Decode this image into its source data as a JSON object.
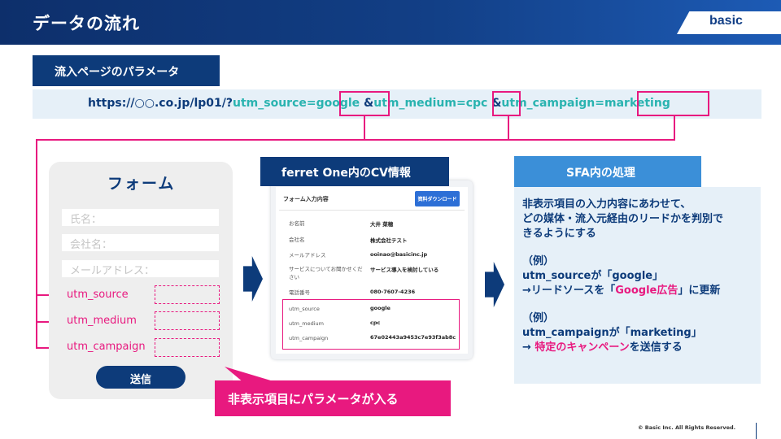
{
  "header": {
    "title": "データの流れ",
    "brand": "basic"
  },
  "params_section": {
    "label": "流入ページのパラメータ",
    "url_prefix": "https://○○.co.jp/lp01/?",
    "p1_key": "utm_source=",
    "p1_value": "google",
    "amp1": "&",
    "p2_key": "utm_medium=",
    "p2_value": "cpc",
    "amp2": "&",
    "p3_key": "utm_campaign=",
    "p3_value": "marketing"
  },
  "form": {
    "title": "フォーム",
    "name_placeholder": "氏名：",
    "company_placeholder": "会社名：",
    "email_placeholder": "メールアドレス：",
    "utm_source": "utm_source",
    "utm_medium": "utm_medium",
    "utm_campaign": "utm_campaign",
    "submit": "送信"
  },
  "callout": "非表示項目にパラメータが入る",
  "ferret": {
    "label": "ferret One内のCV情報",
    "screen_title": "フォーム入力内容",
    "download_button": "資料ダウンロード",
    "rows": [
      {
        "label": "お名前",
        "value": "大井 菜穂"
      },
      {
        "label": "会社名",
        "value": "株式会社テスト"
      },
      {
        "label": "メールアドレス",
        "value": "ooinao@basicinc.jp"
      },
      {
        "label": "サービスについてお聞かせください",
        "value": "サービス導入を検討している"
      },
      {
        "label": "電話番号",
        "value": "080-7607-4236"
      }
    ],
    "utm_rows": [
      {
        "label": "utm_source",
        "value": "google"
      },
      {
        "label": "utm_medium",
        "value": "cpc"
      },
      {
        "label": "utm_campaign",
        "value": "67e02443a9453c7e93f3ab8c"
      }
    ]
  },
  "sfa": {
    "label": "SFA内の処理",
    "desc1": "非表示項目の入力内容にあわせて、",
    "desc2": "どの媒体・流入元経由のリードかを判別で",
    "desc3": "きるようにする",
    "ex1_heading": "（例）",
    "ex1_line1": "utm_sourceが「google」",
    "ex1_line2_pre": "→リードソースを「",
    "ex1_line2_em": "Google広告",
    "ex1_line2_post": "」に更新",
    "ex2_heading": "（例）",
    "ex2_line1": "utm_campaignが「marketing」",
    "ex2_line2_pre": "→ ",
    "ex2_line2_em": "特定のキャンペーン",
    "ex2_line2_post": "を送信する"
  },
  "copyright": "© Basic Inc. All Rights Reserved.",
  "colors": {
    "navy": "#0d3b7a",
    "pink": "#e8197f",
    "teal": "#2ab3b0",
    "sky": "#3b8fd8",
    "pale_blue": "#e6f0f8"
  }
}
